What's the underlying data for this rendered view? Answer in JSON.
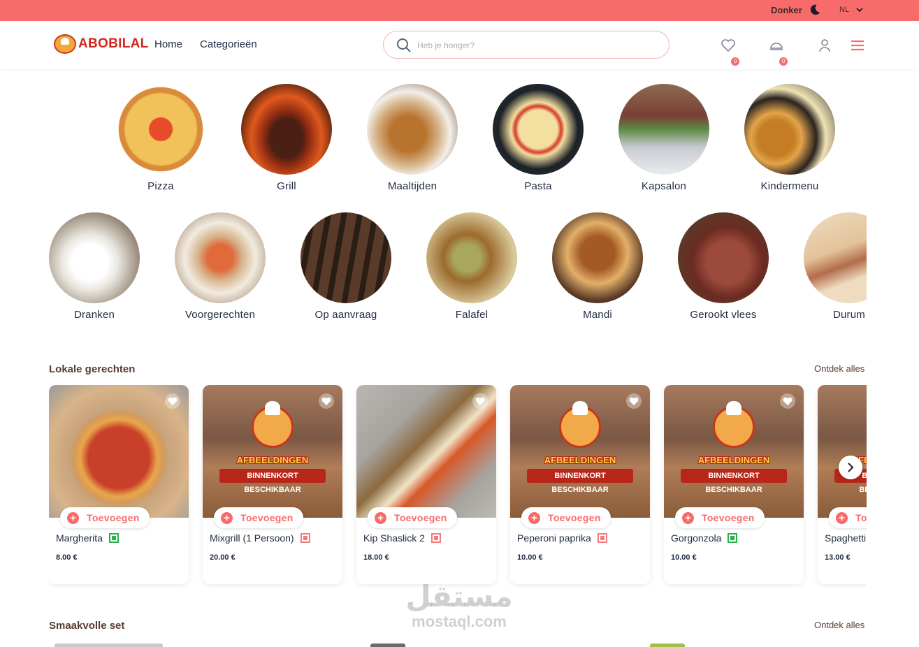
{
  "topbar": {
    "dark_mode_label": "Donker",
    "language": "NL"
  },
  "header": {
    "brand": "ABOBILAL",
    "nav": [
      "Home",
      "Categorieën"
    ],
    "search_placeholder": "Heb je honger?",
    "wishlist_count": "0",
    "cart_count": "0"
  },
  "categories_row1": [
    "Pizza",
    "Grill",
    "Maaltijden",
    "Pasta",
    "Kapsalon",
    "Kindermenu"
  ],
  "categories_row2": [
    "Dranken",
    "Voorgerechten",
    "Op aanvraag",
    "Falafel",
    "Mandi",
    "Gerookt vlees",
    "Durum"
  ],
  "section_local": {
    "title": "Lokale gerechten",
    "link": "Ontdek alles",
    "add_label": "Toevoegen",
    "placeholder_line1": "AFBEELDINGEN",
    "placeholder_line2": "BINNENKORT BESCHIKBAAR",
    "products": [
      {
        "name": "Margherita",
        "price": "8.00 €",
        "diet": "veg"
      },
      {
        "name": "Mixgrill (1 Persoon)",
        "price": "20.00 €",
        "diet": "nonveg"
      },
      {
        "name": "Kip Shaslick 2",
        "price": "18.00 €",
        "diet": "nonveg"
      },
      {
        "name": "Peperoni paprika",
        "price": "10.00 €",
        "diet": "nonveg"
      },
      {
        "name": "Gorgonzola",
        "price": "10.00 €",
        "diet": "veg"
      },
      {
        "name": "Spaghetti",
        "price": "13.00 €",
        "diet": "veg"
      }
    ]
  },
  "section_set": {
    "title": "Smaakvolle set",
    "link": "Ontdek alles"
  },
  "watermark": {
    "arabic": "مستقل",
    "latin": "mostaql.com"
  },
  "colors": {
    "accent": "#f86b6b",
    "veg": "#27b34a",
    "nonveg": "#f47a7a",
    "section_title": "#5a3b2e"
  }
}
